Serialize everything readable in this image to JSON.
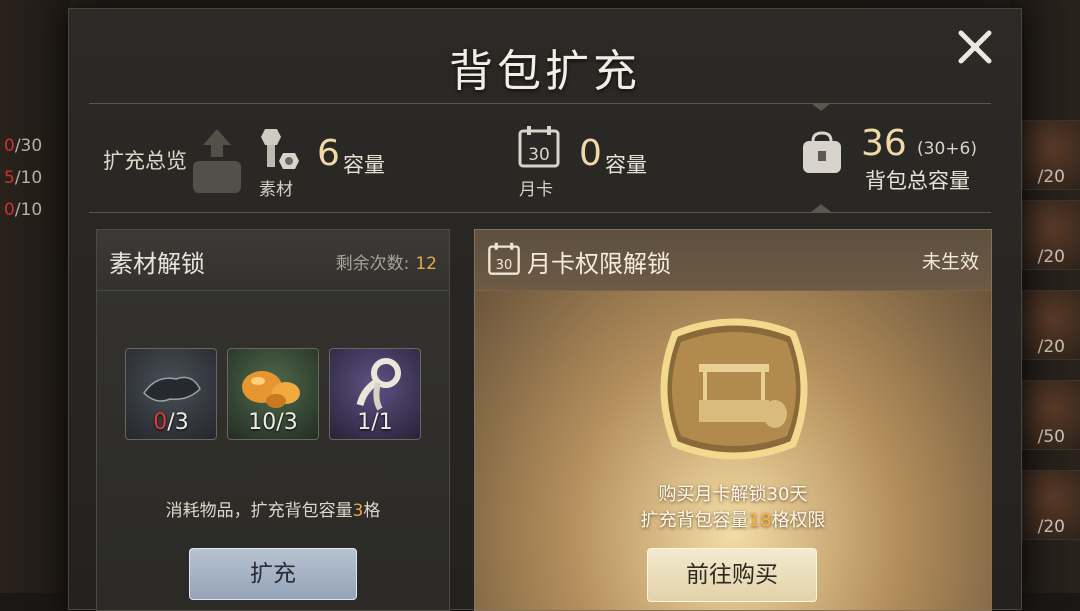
{
  "dialog": {
    "title": "背包扩充",
    "close_icon": "close-x-icon"
  },
  "overview": {
    "label": "扩充总览",
    "material": {
      "value": "6",
      "unit": "容量",
      "label": "素材",
      "icon": "bolt-nut-icon"
    },
    "monthly": {
      "value": "0",
      "unit": "容量",
      "label": "月卡",
      "icon": "calendar-30-icon"
    },
    "total": {
      "value": "36",
      "detail": "(30+6)",
      "label": "背包总容量",
      "icon": "bag-icon"
    }
  },
  "material_unlock": {
    "title": "素材解锁",
    "remaining_label": "剩余次数:",
    "remaining_value": "12",
    "items": [
      {
        "icon": "cloth-icon",
        "have": "0",
        "need": "/3",
        "rarity_color": "#5a6068"
      },
      {
        "icon": "ore-icon",
        "have": "10",
        "need": "/3",
        "rarity_color": "#4b6b4d"
      },
      {
        "icon": "rope-icon",
        "have": "1",
        "need": "/1",
        "rarity_color": "#5d4e7c"
      }
    ],
    "desc_pre": "消耗物品，扩充背包容量",
    "desc_value": "3",
    "desc_post": "格",
    "button": "扩充"
  },
  "monthly_unlock": {
    "title": "月卡权限解锁",
    "status": "未生效",
    "line1": "购买月卡解锁30天",
    "line2_pre": "扩充背包容量",
    "line2_value": "18",
    "line2_post": "格权限",
    "button": "前往购买"
  },
  "background": {
    "left_counters": [
      {
        "have": "0",
        "total": "/30"
      },
      {
        "have": "5",
        "total": "/10"
      },
      {
        "have": "0",
        "total": "/10"
      }
    ],
    "right_slots": [
      "/20",
      "/20",
      "/20",
      "/50",
      "/20"
    ]
  },
  "colors": {
    "accent_orange": "#e7a84a",
    "warning_red": "#e03b33",
    "gold": "#f1d9a6"
  }
}
